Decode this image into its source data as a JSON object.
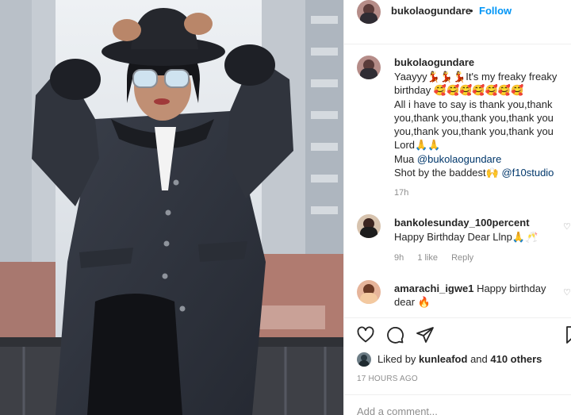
{
  "post": {
    "username": "bukolaogundare",
    "separator": "•",
    "follow_label": "Follow"
  },
  "caption": {
    "username": "bukolaogundare",
    "lines": [
      "Yaayyy💃💃💃It's my freaky freaky",
      "birthday 🥰🥰🥰🥰🥰🥰🥰",
      "All i have to say is thank you,thank",
      "you,thank you,thank you,thank you",
      "you,thank you,thank you,thank you",
      "Lord🙏🙏"
    ],
    "mua_prefix": "Mua ",
    "mua_mention": "@bukolaogundare",
    "shot_prefix": "Shot by the baddest🙌 ",
    "shot_mention": "@f10studio",
    "time": "17h"
  },
  "comments": [
    {
      "username": "bankolesunday_100percent",
      "text": "Happy Birthday Dear Llnp🙏🥂",
      "time": "9h",
      "likes": "1 like",
      "reply": "Reply"
    },
    {
      "username": "amarachi_igwe1",
      "text_first": " Happy birthday",
      "text_second": "dear 🔥"
    }
  ],
  "actions": {
    "like_icon": "heart-icon",
    "comment_icon": "comment-icon",
    "share_icon": "share-icon",
    "save_icon": "bookmark-icon"
  },
  "likes": {
    "prefix": "Liked by ",
    "user": "kunleafod",
    "middle": " and ",
    "others": "410 others"
  },
  "posted": "17 HOURS AGO",
  "add_comment_placeholder": "Add a comment..."
}
